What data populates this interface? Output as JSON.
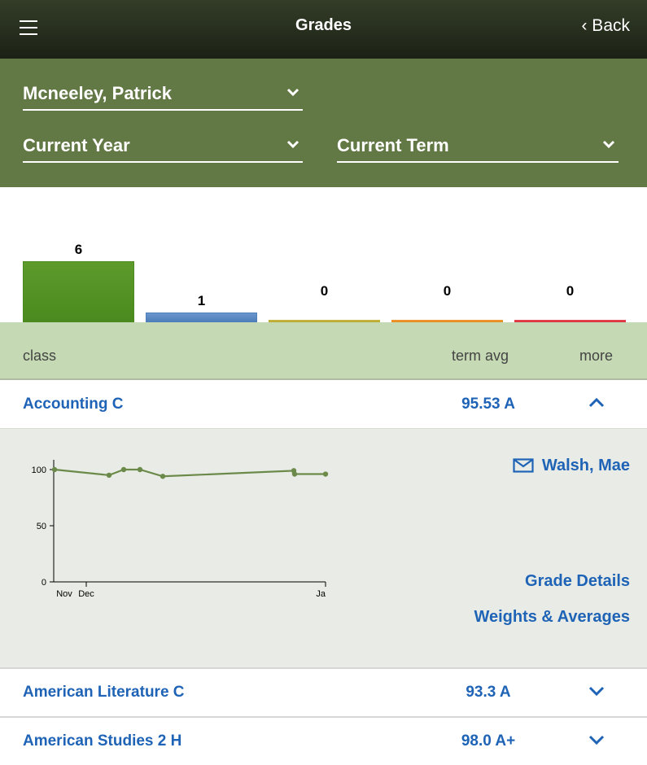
{
  "header": {
    "title": "Grades",
    "back_label": "‹ Back",
    "menu_icon": "hamburger-menu-icon"
  },
  "filters": {
    "student": "Mcneeley, Patrick",
    "year": "Current Year",
    "term": "Current Term"
  },
  "grade_summary": {
    "counts": [
      6,
      1,
      0,
      0,
      0
    ],
    "colors": [
      "#4a8a1e",
      "#4f7fba",
      "#b8a832",
      "#e38a1f",
      "#d9333f"
    ]
  },
  "list_header": {
    "class": "class",
    "term_avg": "term avg",
    "more": "more"
  },
  "classes": [
    {
      "name": "Accounting C",
      "avg": "95.53 A",
      "expanded": true
    },
    {
      "name": "American Literature C",
      "avg": "93.3 A",
      "expanded": false
    },
    {
      "name": "American Studies 2 H",
      "avg": "98.0 A+",
      "expanded": false
    }
  ],
  "detail": {
    "teacher": "Walsh, Mae",
    "grade_details": "Grade Details",
    "weights_averages": "Weights & Averages",
    "chart_data": {
      "type": "line",
      "x_tick_labels": [
        "Nov",
        "Dec",
        "Ja"
      ],
      "y_tick_labels": [
        "100",
        "50",
        "0"
      ],
      "ylim": [
        0,
        100
      ],
      "values": [
        100,
        95,
        100,
        100,
        94,
        99,
        96,
        96
      ],
      "color": "#6b8a4a"
    }
  }
}
